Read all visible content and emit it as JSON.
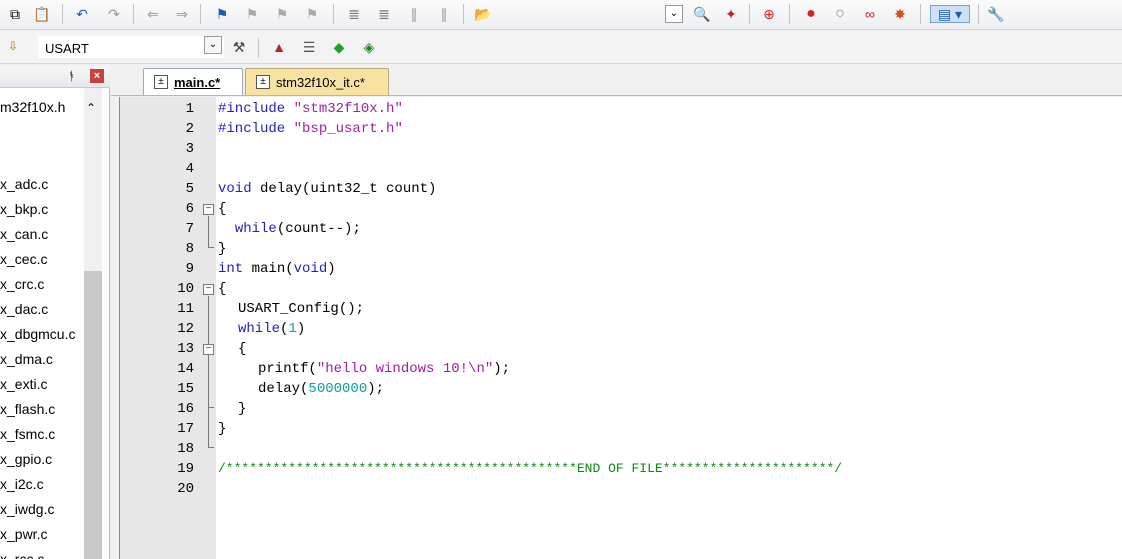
{
  "toolbar": {
    "icons": [
      "copy-icon",
      "paste-icon",
      "undo-icon",
      "redo-icon",
      "nav-back-icon",
      "nav-forward-icon",
      "bookmark-icon",
      "bookmark-prev-icon",
      "bookmark-next-icon",
      "bookmark-clear-icon",
      "indent-icon",
      "unindent-icon",
      "comment-icon",
      "uncomment-icon",
      "open-folder-icon",
      "find-dropdown-icon",
      "find-in-files-icon",
      "debug-icon",
      "start-debug-icon",
      "breakpoint-icon",
      "breakpoint-disable-icon",
      "breakpoint-clear-icon",
      "breakpoint-kill-icon",
      "window-icon",
      "configure-icon"
    ]
  },
  "target": {
    "name": "USART"
  },
  "project": {
    "header_file": "m32f10x.h",
    "files": [
      "x_adc.c",
      "x_bkp.c",
      "x_can.c",
      "x_cec.c",
      "x_crc.c",
      "x_dac.c",
      "x_dbgmcu.c",
      "x_dma.c",
      "x_exti.c",
      "x_flash.c",
      "x_fsmc.c",
      "x_gpio.c",
      "x_i2c.c",
      "x_iwdg.c",
      "x_pwr.c",
      "x_rcc.c"
    ]
  },
  "tabs": [
    {
      "label": "main.c*",
      "active": true
    },
    {
      "label": "stm32f10x_it.c*",
      "active": false
    }
  ],
  "code": {
    "line_numbers": [
      "1",
      "2",
      "3",
      "4",
      "5",
      "6",
      "7",
      "8",
      "9",
      "10",
      "11",
      "12",
      "13",
      "14",
      "15",
      "16",
      "17",
      "18",
      "19",
      "20"
    ],
    "l1_kw": "#include",
    "l1_str": "\"stm32f10x.h\"",
    "l2_kw": "#include",
    "l2_str": "\"bsp_usart.h\"",
    "l5_kw": "void",
    "l5_rest": " delay(uint32_t count)",
    "l6": "{",
    "l7_kw": "while",
    "l7_rest": "(count--);",
    "l8": "}",
    "l9_kw": "int",
    "l9_mid": " main(",
    "l9_kw2": "void",
    "l9_end": ")",
    "l10": "{",
    "l11": "USART_Config();",
    "l12_kw": "while",
    "l12_a": "(",
    "l12_num": "1",
    "l12_b": ")",
    "l13": "{",
    "l14_a": "printf(",
    "l14_str": "\"hello windows 10!\\n\"",
    "l14_b": ");",
    "l15_a": "delay(",
    "l15_num": "5000000",
    "l15_b": ");",
    "l16": "}",
    "l17": "}",
    "l19": "/*********************************************END OF FILE**********************/"
  }
}
